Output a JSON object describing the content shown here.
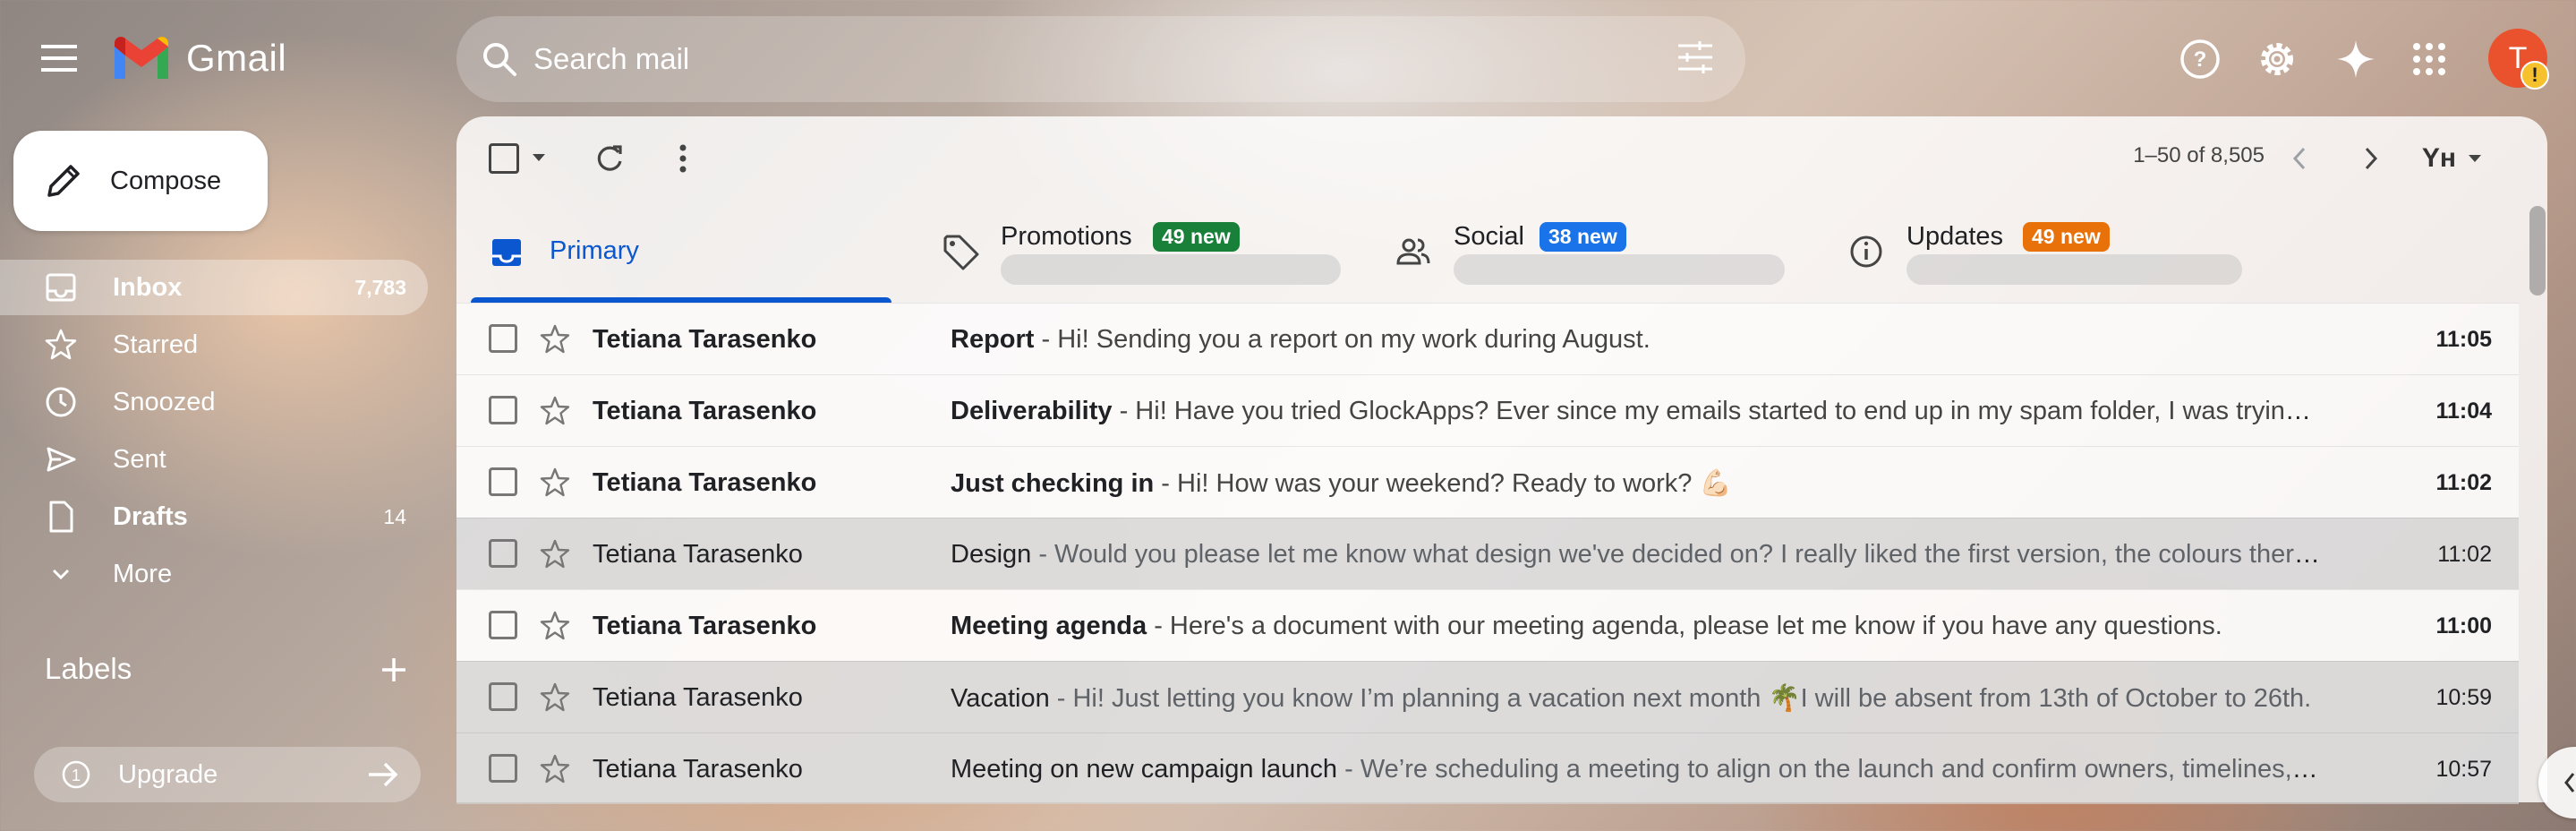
{
  "header": {
    "app_name": "Gmail",
    "search_placeholder": "Search mail",
    "avatar_letter": "T",
    "avatar_badge": "!"
  },
  "sidebar": {
    "compose_label": "Compose",
    "items": [
      {
        "label": "Inbox",
        "count": "7,783",
        "icon": "inbox-icon"
      },
      {
        "label": "Starred",
        "count": "",
        "icon": "star-icon"
      },
      {
        "label": "Snoozed",
        "count": "",
        "icon": "clock-icon"
      },
      {
        "label": "Sent",
        "count": "",
        "icon": "send-icon"
      },
      {
        "label": "Drafts",
        "count": "14",
        "icon": "draft-icon"
      },
      {
        "label": "More",
        "count": "",
        "icon": "chevron-down-icon"
      }
    ],
    "labels_title": "Labels",
    "upgrade_label": "Upgrade"
  },
  "toolbar": {
    "pager": "1–50 of 8,505",
    "input_tools": "Yʜ"
  },
  "tabs": [
    {
      "label": "Primary",
      "badge": ""
    },
    {
      "label": "Promotions",
      "badge": "49 new",
      "badge_color": "#188038"
    },
    {
      "label": "Social",
      "badge": "38 new",
      "badge_color": "#1a73e8"
    },
    {
      "label": "Updates",
      "badge": "49 new",
      "badge_color": "#e8710a"
    }
  ],
  "emails": [
    {
      "sender": "Tetiana Tarasenko",
      "subject": "Report",
      "snippet": " - Hi! Sending you a report on my work during August.",
      "time": "11:05",
      "unread": true
    },
    {
      "sender": "Tetiana Tarasenko",
      "subject": "Deliverability",
      "snippet": " - Hi! Have you tried GlockApps? Ever since my emails started to end up in my spam folder, I was trying to...",
      "time": "11:04",
      "unread": true
    },
    {
      "sender": "Tetiana Tarasenko",
      "subject": "Just checking in",
      "snippet": " - Hi! How was your weekend? Ready to work? 💪🏻",
      "time": "11:02",
      "unread": true
    },
    {
      "sender": "Tetiana Tarasenko",
      "subject": "Design",
      "snippet": " - Would you please let me know what design we've decided on? I really liked the first version, the colours there ...",
      "time": "11:02",
      "unread": false
    },
    {
      "sender": "Tetiana Tarasenko",
      "subject": "Meeting agenda",
      "snippet": " - Here's a document with our meeting agenda, please let me know if you have any questions.",
      "time": "11:00",
      "unread": true
    },
    {
      "sender": "Tetiana Tarasenko",
      "subject": "Vacation",
      "snippet": " - Hi! Just letting you know I’m planning a vacation next month 🌴I will be absent from 13th of October to 26th.",
      "time": "10:59",
      "unread": false
    },
    {
      "sender": "Tetiana Tarasenko",
      "subject": "Meeting on new campaign launch",
      "snippet": " - We’re scheduling a meeting to align on the launch and confirm owners, timelines, a...",
      "time": "10:57",
      "unread": false
    }
  ]
}
